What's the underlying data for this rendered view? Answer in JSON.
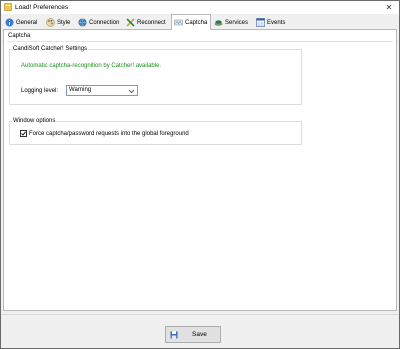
{
  "window": {
    "title": "Load! Preferences",
    "close_glyph": "✕"
  },
  "tabs": [
    {
      "label": "General",
      "icon": "info-icon"
    },
    {
      "label": "Style",
      "icon": "palette-icon"
    },
    {
      "label": "Connection",
      "icon": "globe-icon"
    },
    {
      "label": "Reconnect",
      "icon": "reconnect-icon"
    },
    {
      "label": "Captcha",
      "icon": "captcha-icon",
      "active": true
    },
    {
      "label": "Services",
      "icon": "services-icon"
    },
    {
      "label": "Events",
      "icon": "events-icon"
    }
  ],
  "panel": {
    "title": "Captcha",
    "catcher_group": {
      "title": "CandiSoft Catcher! Settings",
      "info_text": "Automatic captcha-recognition by Catcher! available.",
      "logging_label": "Logging level:",
      "logging_value": "Warning"
    },
    "window_group": {
      "title": "Window options",
      "force_foreground_label": "Force captcha/password requests into the global foreground",
      "force_foreground_checked": true
    }
  },
  "footer": {
    "save_label": "Save"
  },
  "colors": {
    "info_text": "#1a8f1a",
    "accent_border": "#7a9cc6"
  }
}
